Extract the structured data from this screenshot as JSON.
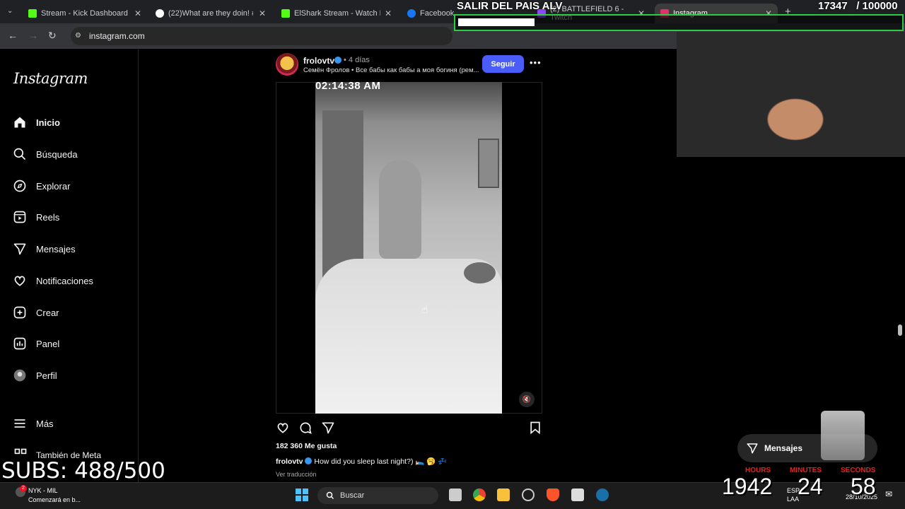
{
  "browser": {
    "tabs": [
      {
        "label": "Stream - Kick Dashboard",
        "favicon_color": "#53fc18"
      },
      {
        "label": "(22)What are they doin! #Sq",
        "favicon_color": "#ffffff"
      },
      {
        "label": "ElShark Stream - Watch Live",
        "favicon_color": "#53fc18"
      },
      {
        "label": "Facebook",
        "favicon_color": "#1877f2"
      },
      {
        "label": "(2) BATTLEFIELD 6 - Twitch",
        "favicon_color": "#9146ff"
      },
      {
        "label": "Instagram",
        "favicon_color": "#e1306c"
      }
    ],
    "url": "instagram.com"
  },
  "instagram": {
    "logo": "Instagram",
    "nav": [
      {
        "label": "Inicio",
        "icon": "home-icon"
      },
      {
        "label": "Búsqueda",
        "icon": "search-icon"
      },
      {
        "label": "Explorar",
        "icon": "compass-icon"
      },
      {
        "label": "Reels",
        "icon": "reels-icon"
      },
      {
        "label": "Mensajes",
        "icon": "send-icon"
      },
      {
        "label": "Notificaciones",
        "icon": "heart-icon"
      },
      {
        "label": "Crear",
        "icon": "plus-square-icon"
      },
      {
        "label": "Panel",
        "icon": "chart-icon"
      },
      {
        "label": "Perfil",
        "icon": "avatar-icon"
      },
      {
        "label": "Más",
        "icon": "menu-icon"
      }
    ],
    "also_meta": "También de Meta",
    "post": {
      "username": "frolovtv",
      "age": "• 4 días",
      "subtitle": "Семён Фролов • Все бабы как бабы а моя богиня (рем...",
      "follow_label": "Seguir",
      "more": "•••",
      "video_timestamp": "02:14:38 AM",
      "likes": "182 360 Me gusta",
      "caption_user": "frolovtv",
      "caption_text": "How did you sleep last night?) 🛌 🥱 💤",
      "translate": "Ver traducción"
    },
    "messages_pill": "Mensajes"
  },
  "overlay": {
    "goal_title": "SALIR DEL PAIS ALV",
    "goal_count": "17347   / 100000",
    "goal_progress": 0.173,
    "subs": "SUBS: 488/500",
    "timer": {
      "hours_label": "HOURS",
      "minutes_label": "MINUTES",
      "seconds_label": "SECONDS",
      "hours": "1942",
      "minutes": "24",
      "seconds": "58"
    }
  },
  "taskbar": {
    "media_title": "NYK - MIL",
    "media_sub": "Comenzará en b...",
    "search_label": "Buscar",
    "lang": "ESP",
    "lang_sub": "LAA",
    "date": "28/10/2025"
  },
  "colors": {
    "follow_button": "#4a5df9",
    "goal_border": "#2ecc40",
    "timer_label": "#e02424"
  }
}
